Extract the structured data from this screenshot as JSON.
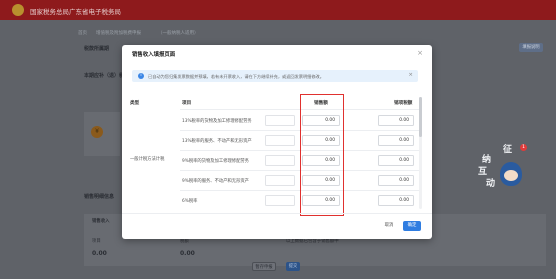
{
  "header": {
    "site_title": "国家税务总局广东省电子税务局"
  },
  "background": {
    "breadcrumb": [
      "首页",
      "增值税及附加税费申报",
      "（一般纳税人适用）"
    ],
    "section_tax_basic": "税款所属期",
    "section_current": "本期应补（退）税",
    "section_sales_detail": "销售明细信息",
    "top_button": "填报说明",
    "section_sales_income": "销售收入",
    "columns": [
      "项目",
      "税额",
      "以上数据已包含于销售额中"
    ],
    "values": [
      "0.00",
      "0.00"
    ],
    "footer_buttons": [
      "暂存申报",
      "提交"
    ]
  },
  "mascot": {
    "chars": [
      "征",
      "纳",
      "互",
      "动"
    ],
    "badge": "1"
  },
  "modal": {
    "title": "销售收入填报页面",
    "notice": "已自动为您归集发票数据并预填，若有未开票收入，请在下方继续补充，或返回发票明细修改。",
    "headers": {
      "category": "类型",
      "item": "项目",
      "sales": "销售额",
      "tax": "销项税额"
    },
    "category": "一般计税方法计税",
    "rows": [
      {
        "item": "13%税率的货物及加工修理修配劳务",
        "sales": "0.00",
        "tax": "0.00"
      },
      {
        "item": "13%税率的服务、不动产和无形资产",
        "sales": "0.00",
        "tax": "0.00"
      },
      {
        "item": "9%税率的货物及加工修理修配劳务",
        "sales": "0.00",
        "tax": "0.00"
      },
      {
        "item": "9%税率的服务、不动产和无形资产",
        "sales": "0.00",
        "tax": "0.00"
      },
      {
        "item": "6%税率",
        "sales": "0.00",
        "tax": "0.00"
      }
    ],
    "cancel": "取消",
    "confirm": "确定"
  },
  "colors": {
    "accent": "#2f7de1",
    "highlight": "#e0312f",
    "topbar": "#8e1a1c"
  }
}
